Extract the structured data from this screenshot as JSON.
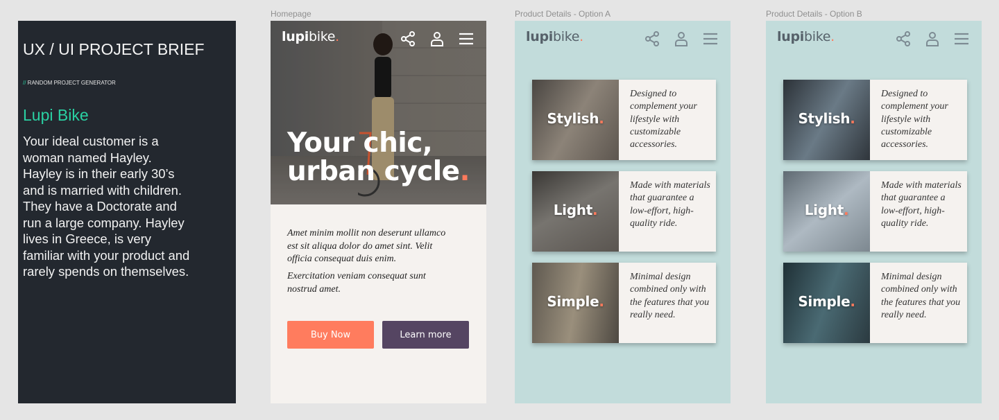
{
  "brief": {
    "title": "UX / UI PROJECT BRIEF",
    "subtitle_slash": "//",
    "subtitle": " RANDOM PROJECT GENERATOR",
    "project_name": "Lupi Bike",
    "description": "Your ideal customer is a woman named Hayley. Hayley is in their early 30’s and is married with children. They have a Doctorate and run a large company. Hayley lives in Greece, is very familiar with your product and rarely spends on themselves."
  },
  "frames": {
    "home_label": "Homepage",
    "option_a_label": "Product Details - Option A",
    "option_b_label": "Product Details - Option B"
  },
  "logo": {
    "bold": "lupi",
    "light": "bike",
    "dot": "."
  },
  "icons": [
    "share-icon",
    "user-icon",
    "menu-icon"
  ],
  "home": {
    "hero_line1": "Your chic,",
    "hero_line2": "urban cycle",
    "hero_dot": ".",
    "copy1": "Amet minim mollit non deserunt ullamco est sit aliqua dolor do amet sint. Velit officia consequat duis enim.",
    "copy2": "Exercitation veniam consequat sunt nostrud amet.",
    "buy_label": "Buy Now",
    "learn_label": "Learn more"
  },
  "features": [
    {
      "title": "Stylish",
      "text": "Designed to complement your lifestyle with customizable accessories."
    },
    {
      "title": "Light",
      "text": "Made with materials that guarantee a low-effort, high-quality ride."
    },
    {
      "title": "Simple",
      "text": "Minimal design combined only with the features that you really need."
    }
  ],
  "colors": {
    "accent": "#ff7a5c",
    "brief_bg": "#23282f",
    "brief_accent": "#2ad1a3",
    "product_bg": "#c2dcdb",
    "learn_button": "#554562",
    "home_bg": "#f5f2ef"
  }
}
